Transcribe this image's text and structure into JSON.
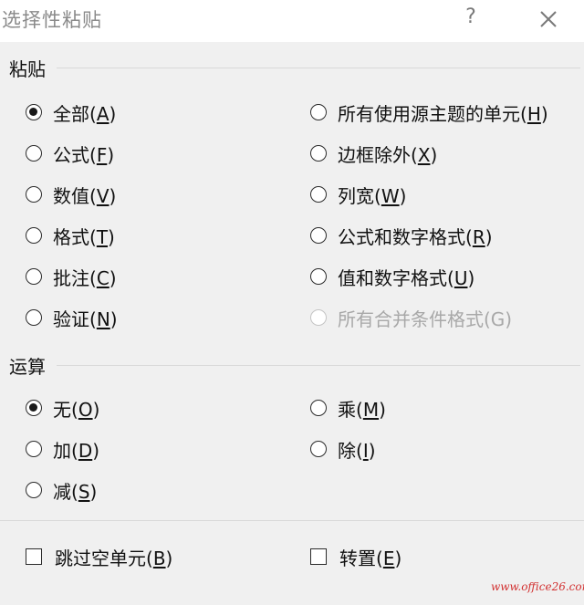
{
  "title": "选择性粘贴",
  "help_label": "?",
  "paste_group": {
    "label": "粘贴",
    "options": [
      {
        "id": "all",
        "label": "全部(",
        "key": "A",
        "suffix": ")",
        "checked": true
      },
      {
        "id": "formulas",
        "label": "公式(",
        "key": "F",
        "suffix": ")",
        "checked": false
      },
      {
        "id": "values",
        "label": "数值(",
        "key": "V",
        "suffix": ")",
        "checked": false
      },
      {
        "id": "formats",
        "label": "格式(",
        "key": "T",
        "suffix": ")",
        "checked": false
      },
      {
        "id": "comments",
        "label": "批注(",
        "key": "C",
        "suffix": ")",
        "checked": false
      },
      {
        "id": "validation",
        "label": "验证(",
        "key": "N",
        "suffix": ")",
        "checked": false
      },
      {
        "id": "all-using-source-theme",
        "label": "所有使用源主题的单元(",
        "key": "H",
        "suffix": ")",
        "checked": false
      },
      {
        "id": "all-except-borders",
        "label": "边框除外(",
        "key": "X",
        "suffix": ")",
        "checked": false
      },
      {
        "id": "column-widths",
        "label": "列宽(",
        "key": "W",
        "suffix": ")",
        "checked": false
      },
      {
        "id": "formulas-and-number-formats",
        "label": "公式和数字格式(",
        "key": "R",
        "suffix": ")",
        "checked": false
      },
      {
        "id": "values-and-number-formats",
        "label": "值和数字格式(",
        "key": "U",
        "suffix": ")",
        "checked": false
      },
      {
        "id": "all-merging-conditional-formats",
        "label": "所有合并条件格式(G)",
        "key": "",
        "suffix": "",
        "checked": false,
        "disabled": true
      }
    ]
  },
  "operation_group": {
    "label": "运算",
    "options": [
      {
        "id": "none",
        "label": "无(",
        "key": "O",
        "suffix": ")",
        "checked": true
      },
      {
        "id": "add",
        "label": "加(",
        "key": "D",
        "suffix": ")",
        "checked": false
      },
      {
        "id": "subtract",
        "label": "减(",
        "key": "S",
        "suffix": ")",
        "checked": false
      },
      {
        "id": "multiply",
        "label": "乘(",
        "key": "M",
        "suffix": ")",
        "checked": false
      },
      {
        "id": "divide",
        "label": "除(",
        "key": "I",
        "suffix": ")",
        "checked": false
      }
    ]
  },
  "checkboxes": {
    "skip_blanks": {
      "label": "跳过空单元(",
      "key": "B",
      "suffix": ")",
      "checked": false
    },
    "transpose": {
      "label": "转置(",
      "key": "E",
      "suffix": ")",
      "checked": false
    }
  },
  "watermark": "www.office26.com",
  "colors": {
    "content_bg": "#f0f0f0",
    "title_text": "#8a8a8a",
    "disabled_text": "#a8a8a8",
    "watermark": "#d23030"
  }
}
